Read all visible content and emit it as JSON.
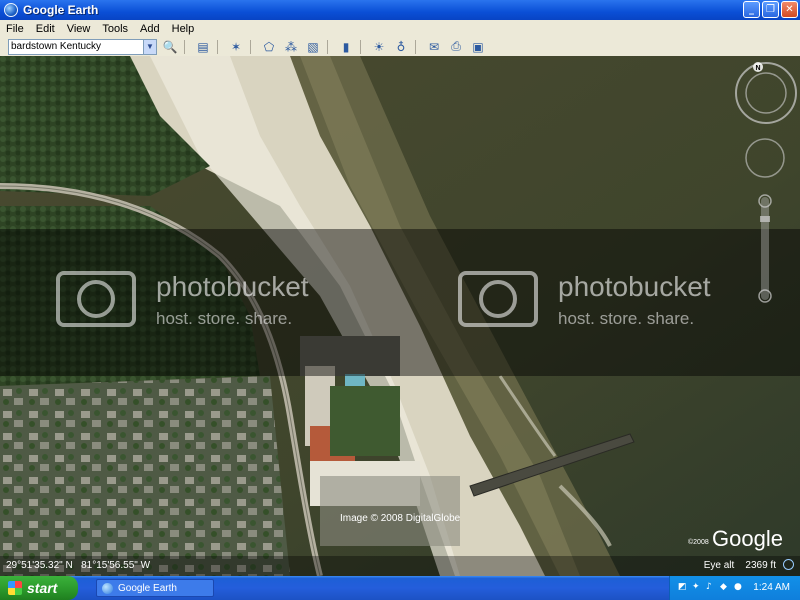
{
  "window": {
    "title": "Google Earth",
    "buttons": [
      "_",
      "❐",
      "✕"
    ]
  },
  "menu": [
    "File",
    "Edit",
    "View",
    "Tools",
    "Add",
    "Help"
  ],
  "toolbar": {
    "search_value": "bardstown Kentucky"
  },
  "map": {
    "watermark_logo": "photobucket",
    "watermark_tag": "host. store. share.",
    "image_credit": "Image © 2008 DigitalGlobe",
    "copyright_year": "©2008",
    "brand": "Google",
    "compass_north": "N"
  },
  "status": {
    "latitude": "29°51'35.32\" N",
    "longitude": "81°15'56.55\" W",
    "eye_alt_label": "Eye alt",
    "eye_alt_value": "2369 ft"
  },
  "taskbar": {
    "start_label": "start",
    "task_label": "Google Earth",
    "clock": "1:24 AM"
  }
}
